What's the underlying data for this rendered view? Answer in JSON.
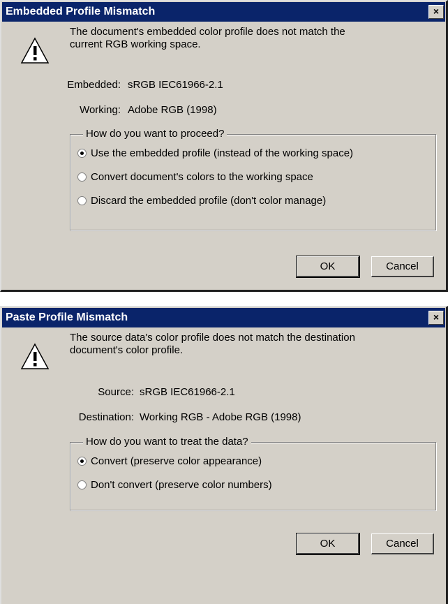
{
  "dialog1": {
    "title": "Embedded Profile Mismatch",
    "close_glyph": "×",
    "message_line1": "The document's embedded color profile does not match the",
    "message_line2": "current RGB working space.",
    "embedded_label": "Embedded:",
    "embedded_value": "sRGB IEC61966-2.1",
    "working_label": "Working:",
    "working_value": "Adobe RGB (1998)",
    "group_title": "How do you want to proceed?",
    "options": [
      {
        "label": "Use the embedded profile (instead of the working space)",
        "checked": true
      },
      {
        "label": "Convert document's colors to the working space",
        "checked": false
      },
      {
        "label": "Discard the embedded profile (don't color manage)",
        "checked": false
      }
    ],
    "ok_label": "OK",
    "cancel_label": "Cancel"
  },
  "dialog2": {
    "title": "Paste Profile Mismatch",
    "close_glyph": "×",
    "message_line1": "The source data's color profile does not match the destination",
    "message_line2": "document's color profile.",
    "source_label": "Source:",
    "source_value": "sRGB IEC61966-2.1",
    "destination_label": "Destination:",
    "destination_value": "Working RGB - Adobe RGB (1998)",
    "group_title": "How do you want to treat the data?",
    "options": [
      {
        "label": "Convert (preserve color appearance)",
        "checked": true
      },
      {
        "label": "Don't convert (preserve color numbers)",
        "checked": false
      }
    ],
    "ok_label": "OK",
    "cancel_label": "Cancel"
  },
  "colors": {
    "titlebar": "#0a246a",
    "dialog_face": "#d4d0c8",
    "warning_fill": "#ffffff"
  },
  "icons": {
    "warning": "warning-icon",
    "close": "close-icon"
  }
}
